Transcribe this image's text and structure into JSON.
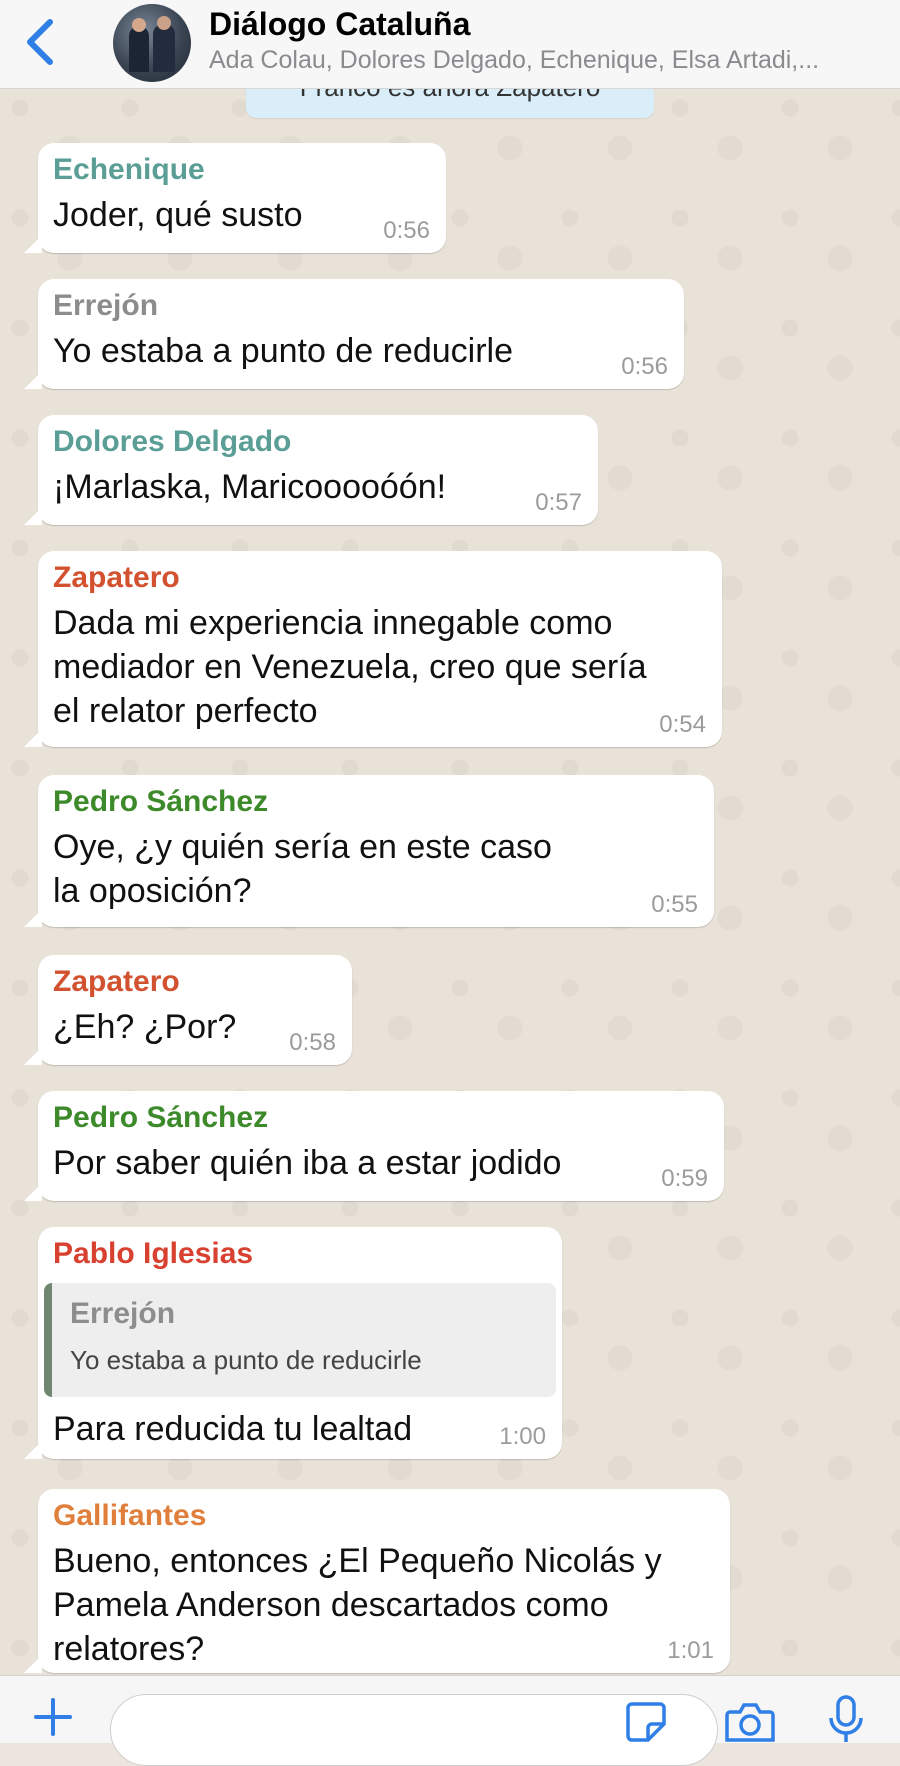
{
  "header": {
    "back_label": "back",
    "title": "Diálogo Cataluña",
    "subtitle": "Ada Colau, Dolores Delgado, Echenique, Elsa Artadi,..."
  },
  "notice": {
    "text": "Franco es ahora Zapatero"
  },
  "messages": [
    {
      "sender": "Echenique",
      "text": "Joder, qué susto",
      "time": "0:56",
      "color": "#5a9e95"
    },
    {
      "sender": "Errejón",
      "text": "Yo estaba a punto de reducirle",
      "time": "0:56",
      "color": "#8c8c8c"
    },
    {
      "sender": "Dolores Delgado",
      "text": "¡Marlaska, Maricooooóón!",
      "time": "0:57",
      "color": "#5a9e95"
    },
    {
      "sender": "Zapatero",
      "text": "Dada mi experiencia innegable como\nmediador en Venezuela, creo que sería\nel relator perfecto",
      "time": "0:54",
      "color": "#d2512f"
    },
    {
      "sender": "Pedro Sánchez",
      "text": "Oye, ¿y quién sería en este caso\nla oposición?",
      "time": "0:55",
      "color": "#3d8a2b"
    },
    {
      "sender": "Zapatero",
      "text": "¿Eh? ¿Por?",
      "time": "0:58",
      "color": "#d2512f"
    },
    {
      "sender": "Pedro Sánchez",
      "text": "Por saber quién iba a estar jodido",
      "time": "0:59",
      "color": "#3d8a2b"
    },
    {
      "sender": "Pablo Iglesias",
      "text": "Para reducida tu lealtad",
      "time": "1:00",
      "color": "#d8402f",
      "quote": {
        "sender": "Errejón",
        "text": "Yo estaba a punto de reducirle"
      }
    },
    {
      "sender": "Gallifantes",
      "text": "Bueno, entonces ¿El Pequeño Nicolás y\nPamela Anderson descartados como\nrelatores?",
      "time": "1:01",
      "color": "#e07f3c"
    }
  ],
  "input": {
    "placeholder": ""
  },
  "icons": [
    "back-icon",
    "plus-icon",
    "sticker-icon",
    "camera-icon",
    "microphone-icon"
  ],
  "accent_color": "#2f7fe6"
}
